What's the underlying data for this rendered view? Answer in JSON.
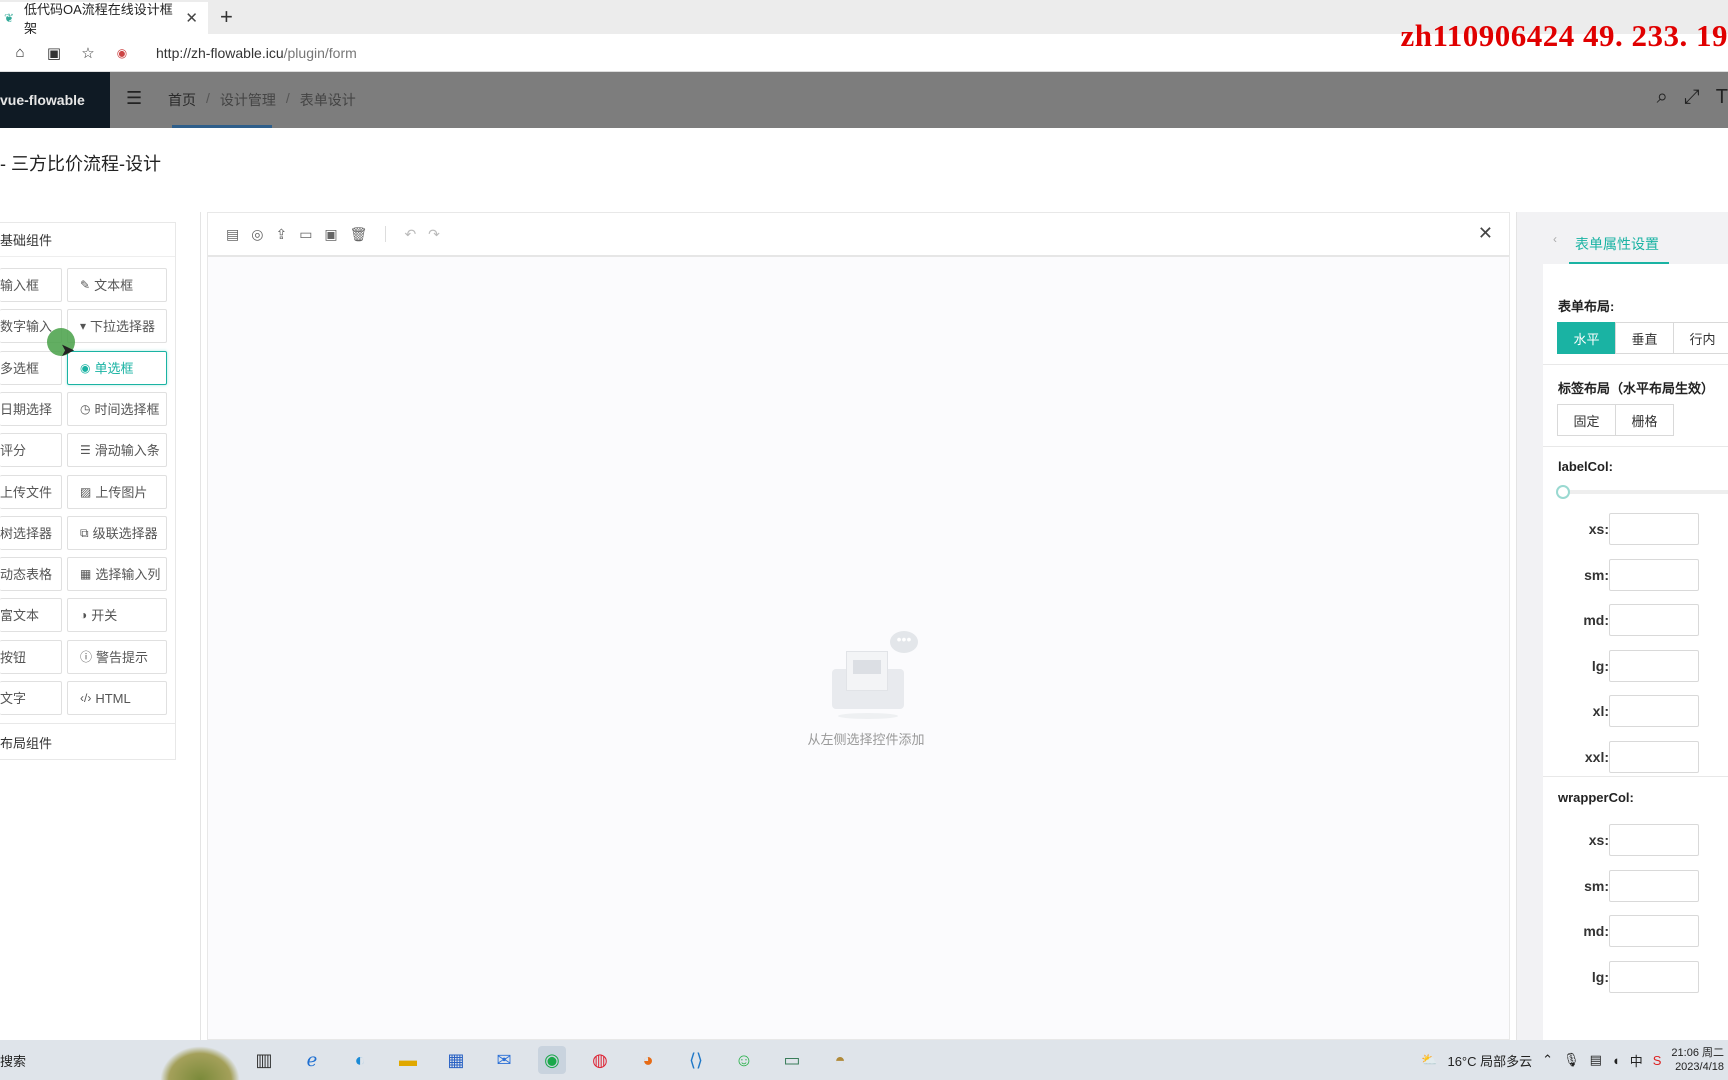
{
  "browser": {
    "tab_title": "低代码OA流程在线设计框架",
    "url_host": "http://zh-flowable.icu",
    "url_path": "/plugin/form",
    "watermark": "zh110906424  49. 233. 19"
  },
  "app": {
    "logo": "vue-flowable",
    "breadcrumb": [
      "首页",
      "设计管理",
      "表单设计"
    ],
    "page_title": "- 三方比价流程-设计"
  },
  "palette": {
    "basic_heading": "基础组件",
    "layout_heading": "布局组件",
    "rows": [
      {
        "left": "输入框",
        "right": "文本框",
        "right_icon": "edit-icon"
      },
      {
        "left": "数字输入",
        "right": "下拉选择器",
        "right_icon": "dropdown-icon"
      },
      {
        "left": "多选框",
        "right": "单选框",
        "right_icon": "radio-icon"
      },
      {
        "left": "日期选择",
        "right": "时间选择框",
        "right_icon": "clock-icon"
      },
      {
        "left": "评分",
        "right": "滑动输入条",
        "right_icon": "slider-icon"
      },
      {
        "left": "上传文件",
        "right": "上传图片",
        "right_icon": "image-icon"
      },
      {
        "left": "树选择器",
        "right": "级联选择器",
        "right_icon": "cascade-icon"
      },
      {
        "left": "动态表格",
        "right": "选择输入列",
        "right_icon": "table-icon"
      },
      {
        "left": "富文本",
        "right": "开关",
        "right_icon": "toggle-icon"
      },
      {
        "left": "按钮",
        "right": "警告提示",
        "right_icon": "alert-icon"
      },
      {
        "left": "文字",
        "right": "HTML",
        "right_icon": "code-icon"
      }
    ]
  },
  "canvas": {
    "empty_text": "从左侧选择控件添加"
  },
  "props": {
    "tab": "表单属性设置",
    "form_layout_label": "表单布局:",
    "form_layout_options": [
      "水平",
      "垂直",
      "行内"
    ],
    "label_layout_label": "标签布局（水平布局生效）",
    "label_layout_options": [
      "固定",
      "栅格"
    ],
    "label_col": "labelCol:",
    "wrapper_col": "wrapperCol:",
    "breakpoints": [
      "xs:",
      "sm:",
      "md:",
      "lg:",
      "xl:",
      "xxl:"
    ],
    "wrapper_breakpoints": [
      "xs:",
      "sm:",
      "md:",
      "lg:"
    ]
  },
  "taskbar": {
    "search": "搜索",
    "weather": "16°C 局部多云",
    "ime": "中",
    "time": "21:06 周二",
    "date": "2023/4/18"
  },
  "colors": {
    "accent": "#1ab3a3",
    "watermark": "#e00000",
    "sidebar_dark": "#0f1a24"
  }
}
